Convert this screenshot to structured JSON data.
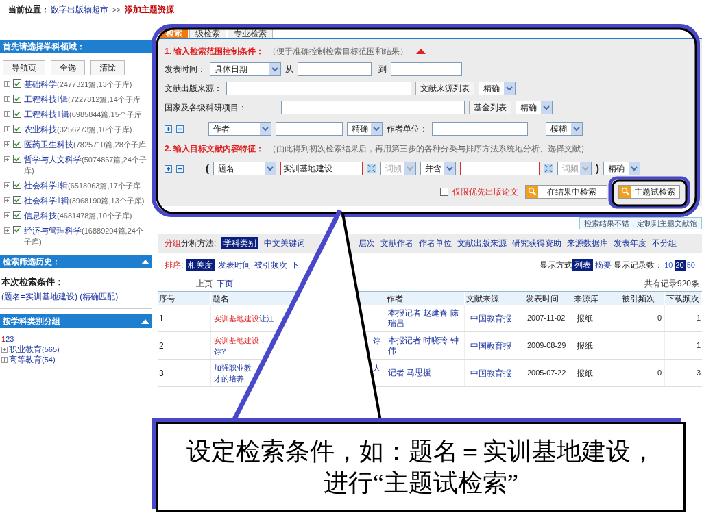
{
  "breadcrumb": {
    "label": "当前位置：",
    "path": "数字出版物超市",
    "separator": ">>",
    "current": "添加主题资源"
  },
  "sidebar": {
    "subject_header": "首先请选择学科领域：",
    "buttons": [
      "导航页",
      "全选",
      "清除"
    ],
    "subjects": [
      {
        "name": "基础科学",
        "count": "(2477321篇,13个子库)",
        "checked": true
      },
      {
        "name": "工程科技Ⅰ辑",
        "count": "(7227812篇,14个子库",
        "checked": true
      },
      {
        "name": "工程科技Ⅱ辑",
        "count": "(6985844篇,15个子库",
        "checked": true
      },
      {
        "name": "农业科技",
        "count": "(3256273篇,10个子库)",
        "checked": true
      },
      {
        "name": "医药卫生科技",
        "count": "(7825710篇,28个子库",
        "checked": true
      },
      {
        "name": "哲学与人文科学",
        "count": "(5074867篇,24个子库)",
        "checked": true
      },
      {
        "name": "社会科学Ⅰ辑",
        "count": "(6518063篇,17个子库",
        "checked": true
      },
      {
        "name": "社会科学Ⅱ辑",
        "count": "(3968190篇,13个子库)",
        "checked": true
      },
      {
        "name": "信息科技",
        "count": "(4681478篇,10个子库)",
        "checked": true
      },
      {
        "name": "经济与管理科学",
        "count": "(16889204篇,24个子库)",
        "checked": true
      }
    ],
    "history_header": "检索筛选历史：",
    "conditions_label": "本次检索条件：",
    "conditions": "(题名=实训基地建设) (精确匹配)",
    "group_header": "按学科类别分组",
    "group_pages": [
      {
        "label": "1",
        "selected": true
      },
      {
        "label": "2",
        "selected": false
      },
      {
        "label": "3",
        "selected": false
      }
    ],
    "groups": [
      {
        "name": "职业教育",
        "count": "(565)"
      },
      {
        "name": "高等教育",
        "count": "(54)"
      }
    ]
  },
  "search": {
    "tabs": [
      {
        "label": "检索",
        "selected": true
      },
      {
        "label": "级检索",
        "selected": false
      },
      {
        "label": "专业检索",
        "selected": false
      }
    ],
    "section1": {
      "title": "1. 输入检索范围控制条件：",
      "hint": "（便于准确控制检索目标范围和结果）"
    },
    "date": {
      "label": "发表时间：",
      "mode": "具体日期",
      "from_label": "从",
      "to_label": "到"
    },
    "source": {
      "label": "文献出版来源：",
      "button": "文献来源列表",
      "match": "精确"
    },
    "fund": {
      "label": "国家及各级科研项目：",
      "button": "基金列表",
      "match": "精确"
    },
    "author": {
      "field": "作者",
      "match": "精确",
      "org_label": "作者单位：",
      "org_match": "模糊"
    },
    "section2": {
      "title": "2. 输入目标文献内容特征：",
      "hint": "（由此得到初次检索结果后，再用第三步的各种分类与排序方法系统地分析、选择文献）"
    },
    "content": {
      "open_paren": "(",
      "field": "题名",
      "value": "实训基地建设",
      "freq1": "词频",
      "logic": "并含",
      "freq2": "词频",
      "close_paren": ")",
      "match": "精确"
    },
    "priority": {
      "label": "仅限优先出版论文",
      "checked": false
    },
    "buttons": [
      "在结果中检索",
      "主题试检索"
    ]
  },
  "notice": "检索结果不错，定制到主题文献馆",
  "grouping": {
    "label_red": "分组",
    "label": "分析方法:",
    "items": [
      {
        "label": "学科类别",
        "selected": true
      },
      {
        "label": "中文关键词",
        "selected": false
      },
      {
        "label": "层次",
        "selected": false
      },
      {
        "label": "文献作者",
        "selected": false
      },
      {
        "label": "作者单位",
        "selected": false
      },
      {
        "label": "文献出版来源",
        "selected": false
      },
      {
        "label": "研究获得资助",
        "selected": false
      },
      {
        "label": "来源数据库",
        "selected": false
      },
      {
        "label": "发表年度",
        "selected": false
      },
      {
        "label": "不分组",
        "selected": false
      }
    ]
  },
  "sort": {
    "label": "排序:",
    "items": [
      {
        "label": "相关度",
        "selected": true
      },
      {
        "label": "发表时间",
        "selected": false
      },
      {
        "label": "被引频次",
        "selected": false
      },
      {
        "label": "下",
        "selected": false
      }
    ]
  },
  "display": {
    "label": "显示方式",
    "modes": [
      {
        "label": "列表",
        "selected": true
      },
      {
        "label": "摘要",
        "selected": false
      }
    ],
    "count_label": "显示记录数：",
    "counts": [
      {
        "label": "10",
        "selected": false
      },
      {
        "label": "20",
        "selected": true
      },
      {
        "label": "50",
        "selected": false
      }
    ]
  },
  "pager": [
    "上页",
    "下页"
  ],
  "total": "共有记录920条",
  "table": {
    "columns": [
      "序号",
      "题名",
      "作者",
      "文献来源",
      "发表时间",
      "来源库",
      "被引频次",
      "下载频次"
    ],
    "rows": [
      {
        "no": "1",
        "title": [
          {
            "highlight": "实训基地建设",
            "text": "让江"
          }
        ],
        "author": "本报记者 赵建春 陈瑞昌",
        "source": "中国教育报",
        "date": "2007-11-02",
        "db": "报纸",
        "cited": "0",
        "downloads": "1"
      },
      {
        "no": "2",
        "title": [
          {
            "highlight": "实训基地建设：",
            "tail": "饽"
          },
          {
            "text": "饽?"
          }
        ],
        "author": "本报记者 时晓玲 钟伟",
        "source": "中国教育报",
        "date": "2009-08-29",
        "db": "报纸",
        "downloads": "1"
      },
      {
        "no": "3",
        "title": [
          {
            "text": "加强职业教",
            "tail": "人"
          },
          {
            "text": "才的培养"
          }
        ],
        "author": "记者 马思援",
        "source": "中国教育报",
        "date": "2005-07-22",
        "db": "报纸",
        "cited": "0",
        "downloads": "3"
      }
    ]
  },
  "callout": "设定检索条件，如：题名＝实训基地建设，进行“主题试检索”"
}
